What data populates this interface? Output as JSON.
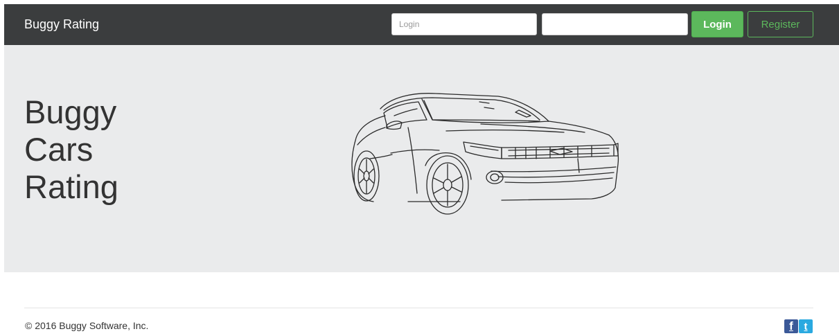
{
  "navbar": {
    "brand": "Buggy Rating",
    "login_placeholder": "Login",
    "password_value": "",
    "login_button": "Login",
    "register_button": "Register"
  },
  "hero": {
    "title_lines": [
      "Buggy",
      "Cars",
      "Rating"
    ]
  },
  "footer": {
    "copyright": "© 2016 Buggy Software, Inc.",
    "social": [
      {
        "icon": "facebook-icon",
        "glyph": "f",
        "color": "#3b5998"
      },
      {
        "icon": "twitter-icon",
        "glyph": "t",
        "color": "#2aa9e0"
      }
    ]
  },
  "colors": {
    "navbar": "#3b3d3e",
    "hero_background": "#eaebec",
    "accent_green": "#5cb85c"
  }
}
